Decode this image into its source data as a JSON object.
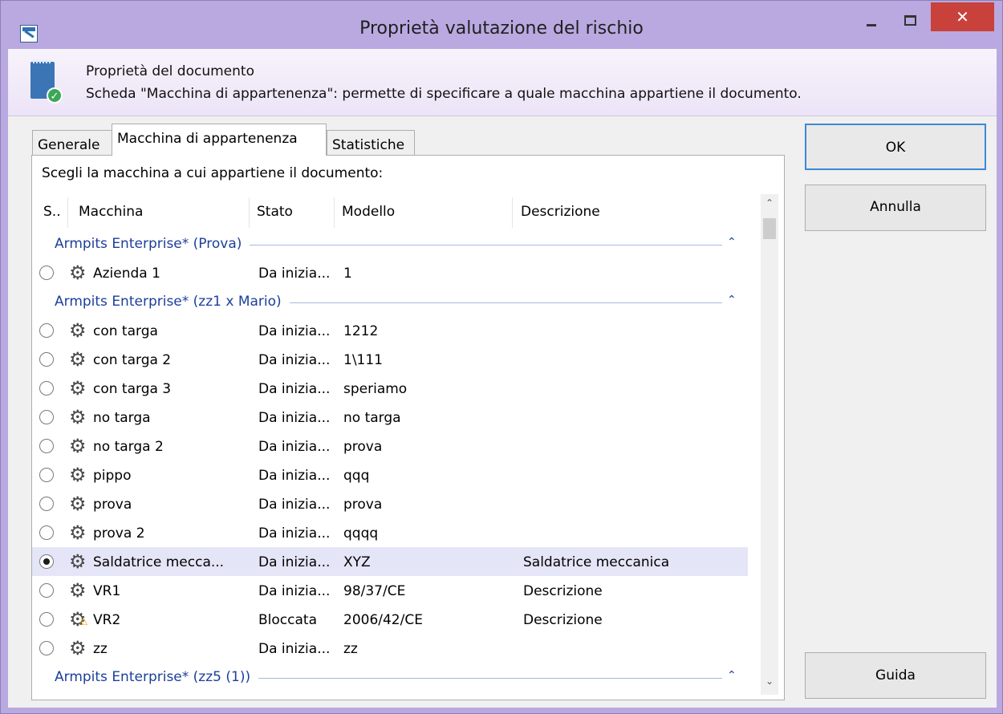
{
  "window": {
    "title": "Proprietà valutazione del rischio",
    "close_glyph": "✕"
  },
  "header": {
    "title": "Proprietà del documento",
    "description": "Scheda \"Macchina di appartenenza\": permette di specificare a quale macchina appartiene il documento."
  },
  "tabs": [
    {
      "label": "Generale",
      "active": false
    },
    {
      "label": "Macchina di appartenenza",
      "active": true
    },
    {
      "label": "Statistiche",
      "active": false
    }
  ],
  "instruction": "Scegli la macchina a cui appartiene il documento:",
  "columns": {
    "s": "S..",
    "macchina": "Macchina",
    "stato": "Stato",
    "modello": "Modello",
    "descrizione": "Descrizione"
  },
  "groups": [
    {
      "label": "Armpits Enterprise* (Prova)",
      "rows": [
        {
          "macchina": "Azienda 1",
          "stato": "Da inizia...",
          "modello": "1",
          "descrizione": "",
          "selected": false,
          "warning": false
        }
      ]
    },
    {
      "label": "Armpits Enterprise* (zz1 x Mario)",
      "rows": [
        {
          "macchina": "con targa",
          "stato": "Da inizia...",
          "modello": "1212",
          "descrizione": "",
          "selected": false,
          "warning": false
        },
        {
          "macchina": "con targa 2",
          "stato": "Da inizia...",
          "modello": "1\\111",
          "descrizione": "",
          "selected": false,
          "warning": false
        },
        {
          "macchina": "con targa 3",
          "stato": "Da inizia...",
          "modello": "speriamo",
          "descrizione": "",
          "selected": false,
          "warning": false
        },
        {
          "macchina": "no targa",
          "stato": "Da inizia...",
          "modello": "no targa",
          "descrizione": "",
          "selected": false,
          "warning": false
        },
        {
          "macchina": "no targa 2",
          "stato": "Da inizia...",
          "modello": "prova",
          "descrizione": "",
          "selected": false,
          "warning": false
        },
        {
          "macchina": "pippo",
          "stato": "Da inizia...",
          "modello": "qqq",
          "descrizione": "",
          "selected": false,
          "warning": false
        },
        {
          "macchina": "prova",
          "stato": "Da inizia...",
          "modello": "prova",
          "descrizione": "",
          "selected": false,
          "warning": false
        },
        {
          "macchina": "prova 2",
          "stato": "Da inizia...",
          "modello": "qqqq",
          "descrizione": "",
          "selected": false,
          "warning": false
        },
        {
          "macchina": "Saldatrice mecca...",
          "stato": "Da inizia...",
          "modello": "XYZ",
          "descrizione": "Saldatrice meccanica",
          "selected": true,
          "warning": false
        },
        {
          "macchina": "VR1",
          "stato": "Da inizia...",
          "modello": "98/37/CE",
          "descrizione": "Descrizione",
          "selected": false,
          "warning": false
        },
        {
          "macchina": "VR2",
          "stato": "Bloccata",
          "modello": "2006/42/CE",
          "descrizione": "Descrizione",
          "selected": false,
          "warning": true
        },
        {
          "macchina": "zz",
          "stato": "Da inizia...",
          "modello": "zz",
          "descrizione": "",
          "selected": false,
          "warning": false
        }
      ]
    },
    {
      "label": "Armpits Enterprise* (zz5 (1))",
      "rows": []
    }
  ],
  "buttons": {
    "ok": "OK",
    "annulla": "Annulla",
    "guida": "Guida"
  },
  "icons": {
    "gear": "⚙",
    "warning": "⚠",
    "caret_up": "⌃",
    "scroll_up": "⌃",
    "scroll_down": "⌄"
  },
  "colors": {
    "titlebar": "#b9a9e0",
    "close_button": "#c8413a",
    "group_label": "#1c3f9a",
    "selected_row": "#e5e5f8",
    "ok_border": "#3c8ad6"
  }
}
